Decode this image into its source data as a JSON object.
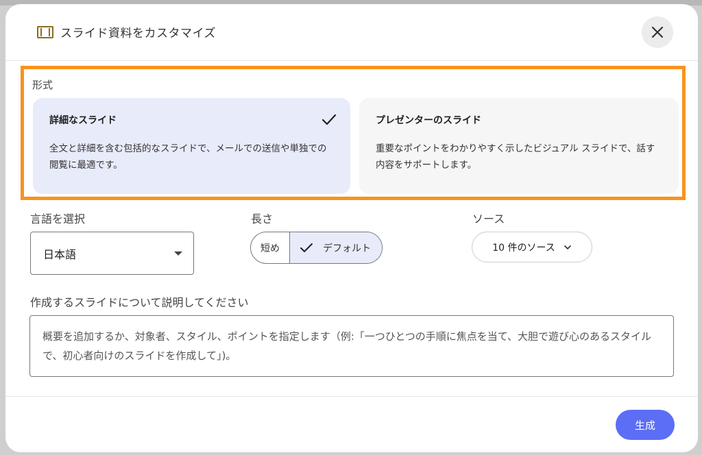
{
  "dialog": {
    "title": "スライド資料をカスタマイズ",
    "icon": "slides-icon"
  },
  "format": {
    "label": "形式",
    "options": [
      {
        "title": "詳細なスライド",
        "description": "全文と詳細を含む包括的なスライドで、メールでの送信や単独での閲覧に最適です。",
        "selected": true
      },
      {
        "title": "プレゼンターのスライド",
        "description": "重要なポイントをわかりやすく示したビジュアル スライドで、話す内容をサポートします。",
        "selected": false
      }
    ]
  },
  "language": {
    "label": "言語を選択",
    "value": "日本語"
  },
  "length": {
    "label": "長さ",
    "options": [
      "短め",
      "デフォルト"
    ],
    "selected": "デフォルト"
  },
  "source": {
    "label": "ソース",
    "button_label": "10 件のソース"
  },
  "description": {
    "label": "作成するスライドについて説明してください",
    "placeholder": "概要を追加するか、対象者、スタイル、ポイントを指定します（例:「一つひとつの手順に焦点を当て、大胆で遊び心のあるスタイルで、初心者向けのスライドを作成して」)。"
  },
  "actions": {
    "generate_label": "生成"
  },
  "colors": {
    "accent": "#5b6ef5",
    "highlight_border": "#f7931e",
    "selected_card": "#e8ebfa"
  }
}
